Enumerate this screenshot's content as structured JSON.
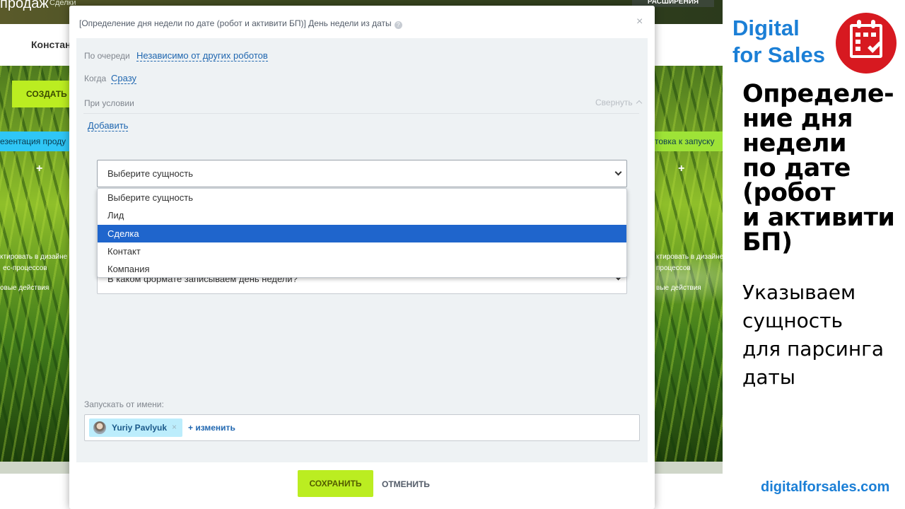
{
  "background": {
    "app_title": "продаж",
    "section": "Сделки",
    "extensions_button": "РАСШИРЕНИЯ",
    "user_fragment": "Констан",
    "create_button": "СОЗДАТЬ",
    "stage_left": "езентация проду",
    "stage_right": "товка к запуску",
    "plus": "+",
    "left_texts": [
      "ктировать в дизайне",
      "ес-процессов",
      "овые действия"
    ],
    "right_texts": [
      "ктировать в дизайнере",
      "процессов",
      "вые действия"
    ]
  },
  "modal": {
    "title": "[Определение дня недели по дате (робот и активити БП)] День недели из даты",
    "queue_label": "По очереди",
    "queue_value": "Независимо от других роботов",
    "when_label": "Когда",
    "when_value": "Сразу",
    "condition_label": "При условии",
    "collapse_label": "Свернуть",
    "add_link": "Добавить",
    "entity_select": {
      "value": "Выберите сущность",
      "options": [
        {
          "label": "Выберите сущность",
          "selected": false
        },
        {
          "label": "Лид",
          "selected": false
        },
        {
          "label": "Сделка",
          "selected": true
        },
        {
          "label": "Контакт",
          "selected": false
        },
        {
          "label": "Компания",
          "selected": false
        }
      ]
    },
    "format_select_value": "В каком формате записываем день недели?",
    "run_as_label": "Запускать от имени:",
    "run_as_user": "Yuriy Pavlyuk",
    "change_link": "+ изменить",
    "save_button": "СОХРАНИТЬ",
    "cancel_button": "ОТМЕНИТЬ"
  },
  "brand": {
    "line1": "Digital",
    "line2": "for Sales",
    "title_lines": [
      "Определе-",
      "ние дня",
      "недели",
      "по дате",
      "(робот",
      "и активити",
      "БП)"
    ],
    "desc_lines": [
      "Указываем",
      "сущность",
      "для парсинга",
      "даты"
    ],
    "site": "digitalforsales.com",
    "colors": {
      "blue": "#1b7fd6",
      "logo_red": "#d71920"
    }
  },
  "colors": {
    "accent_green": "#bbed21",
    "selected_option": "#1f65cc",
    "link": "#2067b0"
  }
}
